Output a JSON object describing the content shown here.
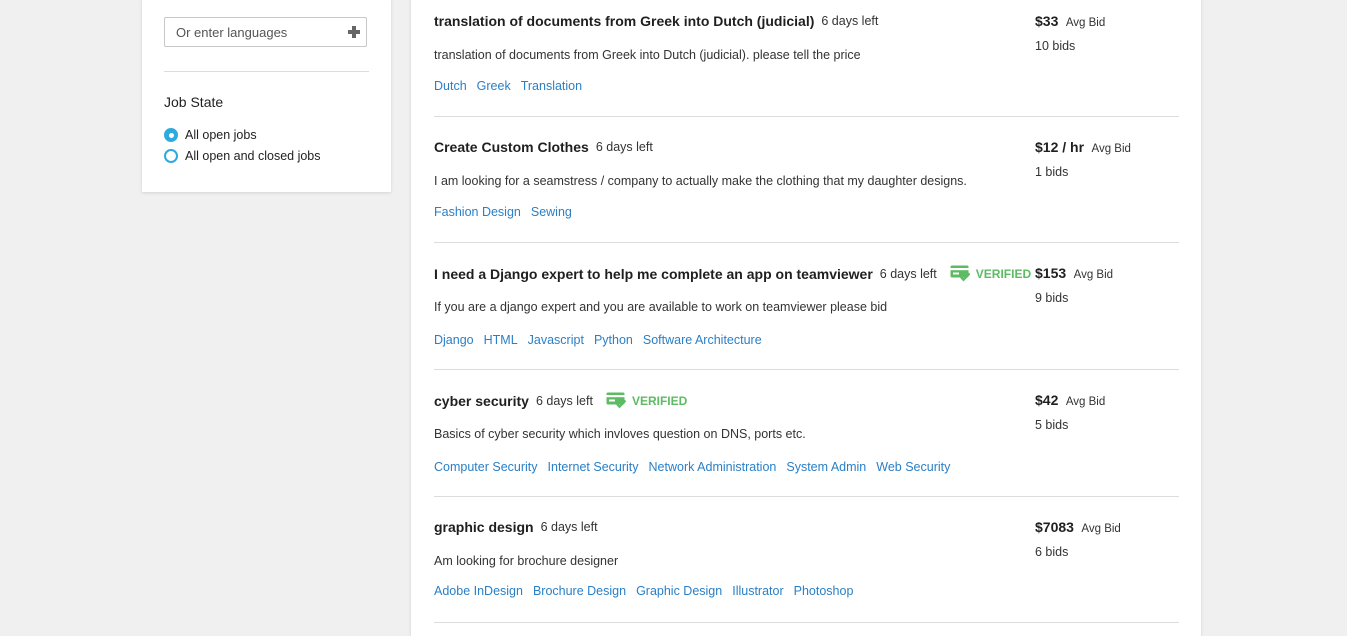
{
  "filters": {
    "language_input_placeholder": "Or enter languages",
    "job_state": {
      "title": "Job State",
      "options": [
        {
          "label": "All open jobs",
          "selected": true
        },
        {
          "label": "All open and closed jobs",
          "selected": false
        }
      ]
    },
    "accent_color": "#2eaadc"
  },
  "colors": {
    "link": "#2a7fc6",
    "verified": "#5dbb63"
  },
  "jobs": [
    {
      "title": "translation of documents from Greek into Dutch (judicial)",
      "days_left": "6 days left",
      "verified": "",
      "description": "translation of documents from Greek into Dutch (judicial). please tell the price",
      "tags": [
        "Dutch",
        "Greek",
        "Translation"
      ],
      "bid_amount": "$33",
      "bid_label": "Avg Bid",
      "bids": "10 bids"
    },
    {
      "title": "Create Custom Clothes",
      "days_left": "6 days left",
      "verified": "",
      "description": "I am looking for a seamstress / company to actually make the clothing that my daughter designs.",
      "tags": [
        "Fashion Design",
        "Sewing"
      ],
      "bid_amount": "$12 / hr",
      "bid_label": "Avg Bid",
      "bids": "1 bids"
    },
    {
      "title": "I need a Django expert to help me complete an app on teamviewer",
      "days_left": "6 days left",
      "verified": "VERIFIED",
      "description": "If you are a django expert and you are available to work on teamviewer please bid",
      "tags": [
        "Django",
        "HTML",
        "Javascript",
        "Python",
        "Software Architecture"
      ],
      "bid_amount": "$153",
      "bid_label": "Avg Bid",
      "bids": "9 bids"
    },
    {
      "title": "cyber security",
      "days_left": "6 days left",
      "verified": "VERIFIED",
      "description": "Basics of cyber security which invloves question on DNS, ports etc.",
      "tags": [
        "Computer Security",
        "Internet Security",
        "Network Administration",
        "System Admin",
        "Web Security"
      ],
      "bid_amount": "$42",
      "bid_label": "Avg Bid",
      "bids": "5 bids"
    },
    {
      "title": "graphic design",
      "days_left": "6 days left",
      "verified": "",
      "description": "Am looking for brochure designer",
      "tags": [
        "Adobe InDesign",
        "Brochure Design",
        "Graphic Design",
        "Illustrator",
        "Photoshop"
      ],
      "bid_amount": "$7083",
      "bid_label": "Avg Bid",
      "bids": "6 bids"
    }
  ]
}
